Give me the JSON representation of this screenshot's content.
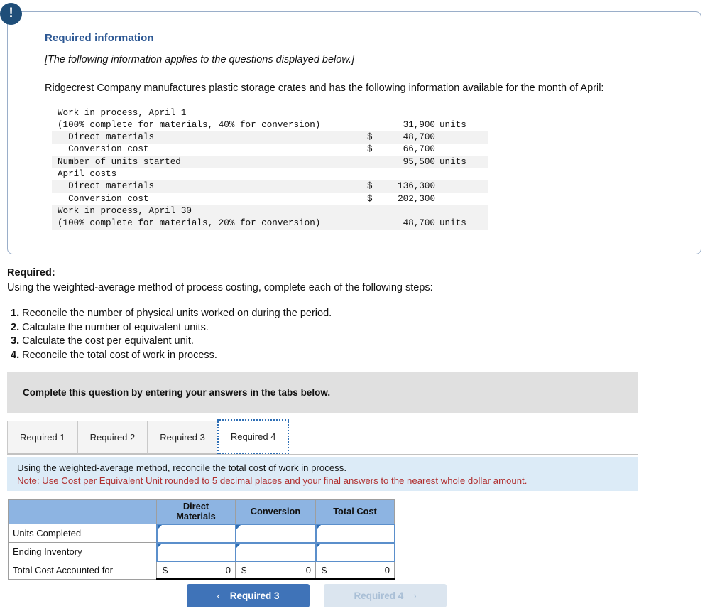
{
  "alert": {
    "icon": "exclamation-icon",
    "glyph": "!"
  },
  "required_information": {
    "title": "Required information",
    "applies_note": "[The following information applies to the questions displayed below.]",
    "paragraph": "Ridgecrest Company manufactures plastic storage crates and has the following information available for the month of April:",
    "data_rows": [
      {
        "label": "Work in process, April 1",
        "amount": "",
        "unit": "",
        "stripe": false
      },
      {
        "label": "(100% complete for materials, 40% for conversion)",
        "amount": "31,900",
        "unit": "units",
        "stripe": false
      },
      {
        "label": "  Direct materials",
        "amount": "48,700",
        "dollar": "$",
        "unit": "",
        "stripe": true
      },
      {
        "label": "  Conversion cost",
        "amount": "66,700",
        "dollar": "$",
        "unit": "",
        "stripe": false
      },
      {
        "label": "Number of units started",
        "amount": "95,500",
        "unit": "units",
        "stripe": true
      },
      {
        "label": "April costs",
        "amount": "",
        "unit": "",
        "stripe": false
      },
      {
        "label": "  Direct materials",
        "amount": "136,300",
        "dollar": "$",
        "unit": "",
        "stripe": true
      },
      {
        "label": "  Conversion cost",
        "amount": "202,300",
        "dollar": "$",
        "unit": "",
        "stripe": false
      },
      {
        "label": "Work in process, April 30",
        "amount": "",
        "unit": "",
        "stripe": true
      },
      {
        "label": "(100% complete for materials, 20% for conversion)",
        "amount": "48,700",
        "unit": "units",
        "stripe": true
      }
    ]
  },
  "required_section": {
    "heading": "Required:",
    "subheading": "Using the weighted-average method of process costing, complete each of the following steps:",
    "steps": [
      {
        "num": "1.",
        "text": "Reconcile the number of physical units worked on during the period."
      },
      {
        "num": "2.",
        "text": "Calculate the number of equivalent units."
      },
      {
        "num": "3.",
        "text": "Calculate the cost per equivalent unit."
      },
      {
        "num": "4.",
        "text": "Reconcile the total cost of work in process."
      }
    ]
  },
  "instruction_bar": {
    "text": "Complete this question by entering your answers in the tabs below."
  },
  "tabs": [
    {
      "label": "Required 1",
      "active": false
    },
    {
      "label": "Required 2",
      "active": false
    },
    {
      "label": "Required 3",
      "active": false
    },
    {
      "label": "Required 4",
      "active": true
    }
  ],
  "info_banner": {
    "line1": "Using the weighted-average method, reconcile the total cost of work in process.",
    "note": "Note: Use Cost per Equivalent Unit rounded to 5 decimal places and your final answers to the nearest whole dollar amount."
  },
  "answer_table": {
    "headers": [
      "",
      "Direct Materials",
      "Conversion",
      "Total Cost"
    ],
    "header_dm_line1": "Direct",
    "header_dm_line2": "Materials",
    "header_conversion": "Conversion",
    "header_total": "Total Cost",
    "rows": [
      {
        "label": "Units Completed",
        "type": "input",
        "dm": "",
        "conversion": "",
        "total": ""
      },
      {
        "label": "Ending Inventory",
        "type": "input",
        "dm": "",
        "conversion": "",
        "total": ""
      },
      {
        "label": "Total Cost Accounted for",
        "type": "money",
        "dollar": "$",
        "dm": "0",
        "conversion": "0",
        "total": "0"
      }
    ]
  },
  "nav": {
    "prev_label": "Required 3",
    "prev_chevron": "‹",
    "next_label": "Required 4",
    "next_chevron": "›"
  },
  "colors": {
    "header_blue": "#8db4e2",
    "banner_blue": "#dcebf7",
    "note_red": "#b03030",
    "title_blue": "#2d5894",
    "badge_blue": "#1f4e79",
    "button_blue": "#3f73b8",
    "button_disabled": "#dbe5ef",
    "gray_bar": "#e0e0e0"
  }
}
